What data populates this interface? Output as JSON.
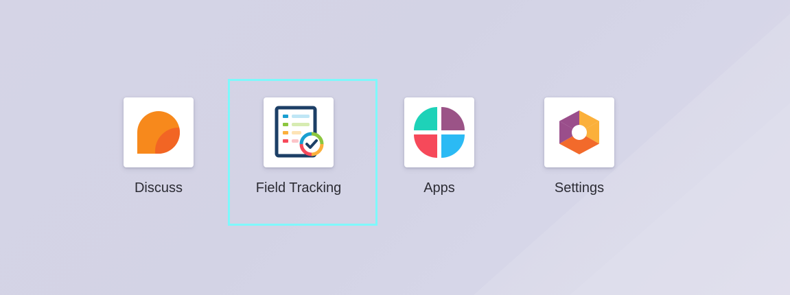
{
  "apps": [
    {
      "id": "discuss",
      "label": "Discuss",
      "icon": "discuss-bubble-icon"
    },
    {
      "id": "field-tracking",
      "label": "Field Tracking",
      "icon": "field-tracking-checklist-icon",
      "focused": true
    },
    {
      "id": "apps",
      "label": "Apps",
      "icon": "apps-quadrant-icon"
    },
    {
      "id": "settings",
      "label": "Settings",
      "icon": "settings-hexagon-icon"
    }
  ],
  "colors": {
    "background": "#d5d4e6",
    "focus_outline": "#7ef8fb",
    "label_text": "#2b2b33",
    "discuss_orange": "#f7891c",
    "discuss_dark_orange": "#f26524",
    "apps_teal": "#1ed2b8",
    "apps_purple": "#9b5387",
    "apps_red": "#f6495a",
    "apps_blue": "#2bbaf4",
    "settings_purple": "#9a4e8b",
    "settings_yellow": "#fbb03b",
    "settings_orange": "#f26a2b",
    "tracking_navy": "#1c3f66"
  }
}
